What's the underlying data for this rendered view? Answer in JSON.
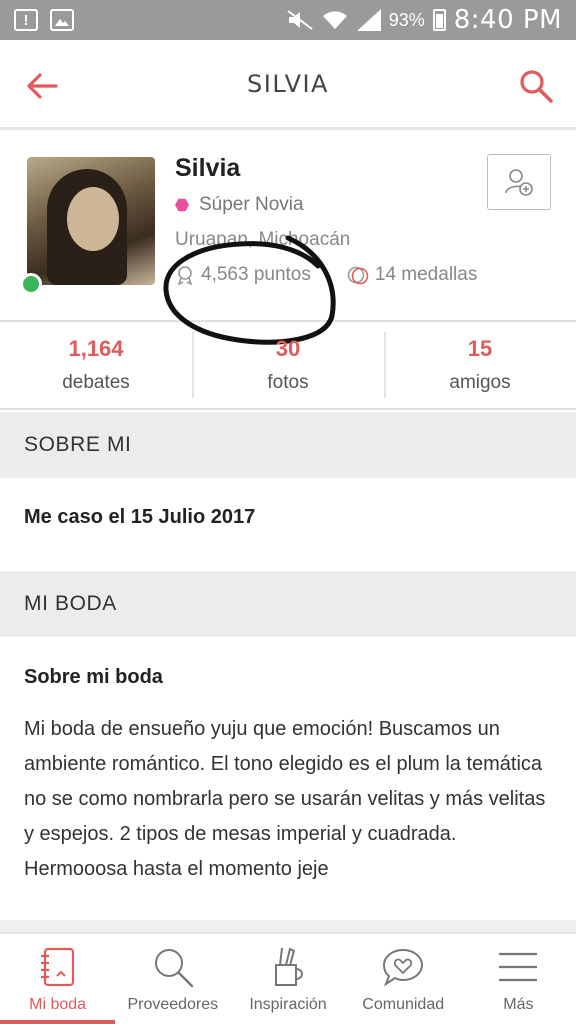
{
  "status_bar": {
    "battery": "93%",
    "time": "8:40 PM"
  },
  "header": {
    "title": "SILVIA"
  },
  "profile": {
    "name": "Silvia",
    "rank": "Súper Novia",
    "location": "Uruapan, Michoacán",
    "points": "4,563 puntos",
    "medals": "14 medallas"
  },
  "counters": [
    {
      "value": "1,164",
      "label": "debates"
    },
    {
      "value": "30",
      "label": "fotos"
    },
    {
      "value": "15",
      "label": "amigos"
    }
  ],
  "sobre_mi": {
    "heading": "SOBRE MI",
    "text": "Me caso el 15 Julio 2017"
  },
  "mi_boda": {
    "heading": "MI BODA",
    "subtitle": "Sobre mi boda",
    "text": "Mi boda de ensueño yuju que emoción! Buscamos un ambiente romántico. El tono elegido es el plum la temática no se como nombrarla pero se usarán velitas y más velitas y espejos. 2 tipos de mesas imperial y cuadrada. Hermooosa hasta el momento jeje"
  },
  "bottom_nav": [
    {
      "label": "Mi boda",
      "icon": "notebook-icon",
      "active": true
    },
    {
      "label": "Proveedores",
      "icon": "search-icon",
      "active": false
    },
    {
      "label": "Inspiración",
      "icon": "pencil-cup-icon",
      "active": false
    },
    {
      "label": "Comunidad",
      "icon": "heart-chat-icon",
      "active": false
    },
    {
      "label": "Más",
      "icon": "menu-icon",
      "active": false
    }
  ],
  "colors": {
    "accent": "#e05c5c",
    "online": "#3cb55a",
    "rank_badge": "#e94f9e"
  }
}
